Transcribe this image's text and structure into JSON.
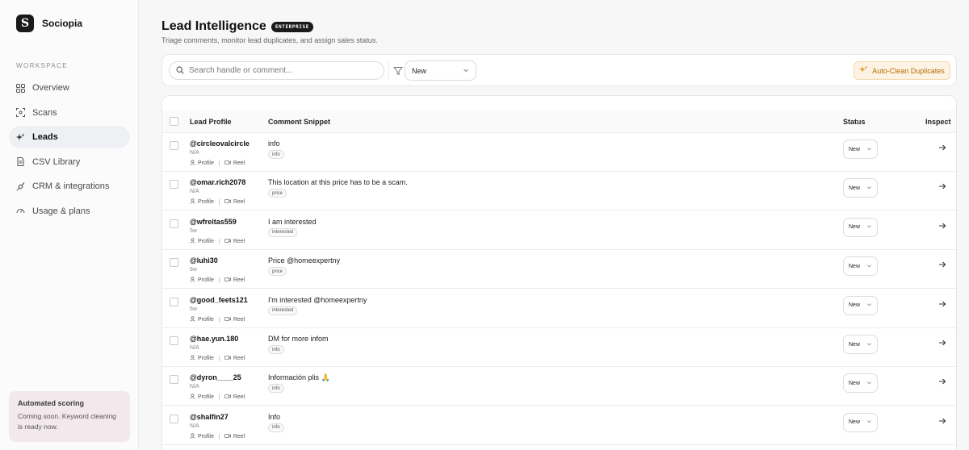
{
  "brand": {
    "name": "Sociopia",
    "logo_letter": "S"
  },
  "sidebar": {
    "section_label": "WORKSPACE",
    "items": [
      {
        "label": "Overview",
        "icon": "grid-icon"
      },
      {
        "label": "Scans",
        "icon": "scan-icon"
      },
      {
        "label": "Leads",
        "icon": "sparkle-icon",
        "active": true
      },
      {
        "label": "CSV Library",
        "icon": "file-icon"
      },
      {
        "label": "CRM & integrations",
        "icon": "plug-icon"
      },
      {
        "label": "Usage & plans",
        "icon": "gauge-icon"
      }
    ],
    "promo": {
      "title": "Automated scoring",
      "text": "Coming soon. Keyword cleaning is ready now."
    }
  },
  "header": {
    "title": "Lead Intelligence",
    "badge": "ENTERPRISE",
    "subtitle": "Triage comments, monitor lead duplicates, and assign sales status."
  },
  "toolbar": {
    "search_placeholder": "Search handle or comment...",
    "filter_value": "New",
    "autoclean_label": "Auto-Clean Duplicates"
  },
  "table": {
    "columns": {
      "profile": "Lead Profile",
      "comment": "Comment Snippet",
      "status": "Status",
      "inspect": "Inspect"
    },
    "profile_link": "Profile",
    "reel_link": "Reel",
    "rows": [
      {
        "handle": "@circleovalcircle",
        "age": "N/A",
        "comment": "info",
        "tag": "info",
        "status": "New"
      },
      {
        "handle": "@omar.rich2078",
        "age": "N/A",
        "comment": "This location at this price has to be a scam.",
        "tag": "price",
        "status": "New"
      },
      {
        "handle": "@wfreitas559",
        "age": "5w",
        "comment": "I am interested",
        "tag": "interested",
        "status": "New"
      },
      {
        "handle": "@luhi30",
        "age": "6w",
        "comment": "Price @homeexpertny",
        "tag": "price",
        "status": "New"
      },
      {
        "handle": "@good_feets121",
        "age": "6w",
        "comment": "I'm interested @homeexpertny",
        "tag": "interested",
        "status": "New"
      },
      {
        "handle": "@hae.yun.180",
        "age": "N/A",
        "comment": "DM for more infom",
        "tag": "info",
        "status": "New"
      },
      {
        "handle": "@dyron____25",
        "age": "N/A",
        "comment": "Información plis 🙏",
        "tag": "info",
        "status": "New"
      },
      {
        "handle": "@shalfin27",
        "age": "N/A",
        "comment": "Info",
        "tag": "info",
        "status": "New"
      }
    ]
  }
}
